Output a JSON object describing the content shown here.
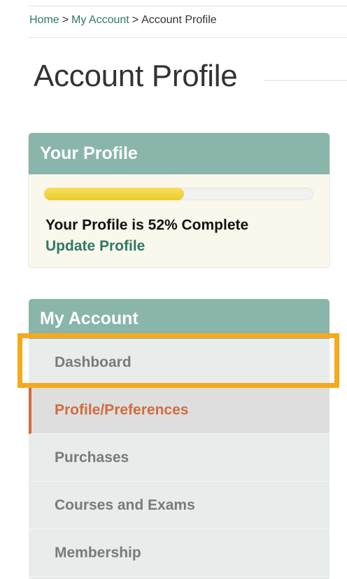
{
  "breadcrumb": {
    "home": "Home",
    "sep1": ">",
    "my_account": "My Account",
    "sep2": ">",
    "current": "Account Profile"
  },
  "page": {
    "title": "Account Profile"
  },
  "profile_card": {
    "title": "Your Profile",
    "progress_percent": 52,
    "completion_text": "Your Profile is 52% Complete",
    "update_link": "Update Profile"
  },
  "account_menu": {
    "title": "My Account",
    "items": [
      {
        "label": "Dashboard",
        "active": false,
        "highlighted": true
      },
      {
        "label": "Profile/Preferences",
        "active": true,
        "highlighted": false
      },
      {
        "label": "Purchases",
        "active": false,
        "highlighted": false
      },
      {
        "label": "Courses and Exams",
        "active": false,
        "highlighted": false
      },
      {
        "label": "Membership",
        "active": false,
        "highlighted": false
      }
    ]
  },
  "colors": {
    "brand_green": "#2e7a64",
    "card_header": "#89b5ab",
    "active_orange": "#d06c3f",
    "progress_yellow": "#eccb2a",
    "highlight": "#f5a91d"
  }
}
